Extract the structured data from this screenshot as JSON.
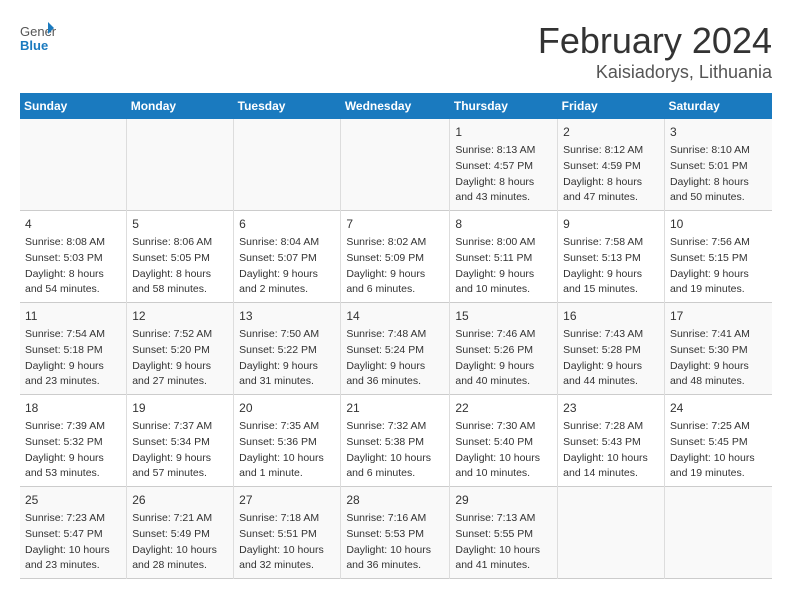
{
  "header": {
    "logo_general": "General",
    "logo_blue": "Blue",
    "title": "February 2024",
    "location": "Kaisiadorys, Lithuania"
  },
  "weekdays": [
    "Sunday",
    "Monday",
    "Tuesday",
    "Wednesday",
    "Thursday",
    "Friday",
    "Saturday"
  ],
  "weeks": [
    [
      {
        "day": "",
        "info": ""
      },
      {
        "day": "",
        "info": ""
      },
      {
        "day": "",
        "info": ""
      },
      {
        "day": "",
        "info": ""
      },
      {
        "day": "1",
        "info": "Sunrise: 8:13 AM\nSunset: 4:57 PM\nDaylight: 8 hours\nand 43 minutes."
      },
      {
        "day": "2",
        "info": "Sunrise: 8:12 AM\nSunset: 4:59 PM\nDaylight: 8 hours\nand 47 minutes."
      },
      {
        "day": "3",
        "info": "Sunrise: 8:10 AM\nSunset: 5:01 PM\nDaylight: 8 hours\nand 50 minutes."
      }
    ],
    [
      {
        "day": "4",
        "info": "Sunrise: 8:08 AM\nSunset: 5:03 PM\nDaylight: 8 hours\nand 54 minutes."
      },
      {
        "day": "5",
        "info": "Sunrise: 8:06 AM\nSunset: 5:05 PM\nDaylight: 8 hours\nand 58 minutes."
      },
      {
        "day": "6",
        "info": "Sunrise: 8:04 AM\nSunset: 5:07 PM\nDaylight: 9 hours\nand 2 minutes."
      },
      {
        "day": "7",
        "info": "Sunrise: 8:02 AM\nSunset: 5:09 PM\nDaylight: 9 hours\nand 6 minutes."
      },
      {
        "day": "8",
        "info": "Sunrise: 8:00 AM\nSunset: 5:11 PM\nDaylight: 9 hours\nand 10 minutes."
      },
      {
        "day": "9",
        "info": "Sunrise: 7:58 AM\nSunset: 5:13 PM\nDaylight: 9 hours\nand 15 minutes."
      },
      {
        "day": "10",
        "info": "Sunrise: 7:56 AM\nSunset: 5:15 PM\nDaylight: 9 hours\nand 19 minutes."
      }
    ],
    [
      {
        "day": "11",
        "info": "Sunrise: 7:54 AM\nSunset: 5:18 PM\nDaylight: 9 hours\nand 23 minutes."
      },
      {
        "day": "12",
        "info": "Sunrise: 7:52 AM\nSunset: 5:20 PM\nDaylight: 9 hours\nand 27 minutes."
      },
      {
        "day": "13",
        "info": "Sunrise: 7:50 AM\nSunset: 5:22 PM\nDaylight: 9 hours\nand 31 minutes."
      },
      {
        "day": "14",
        "info": "Sunrise: 7:48 AM\nSunset: 5:24 PM\nDaylight: 9 hours\nand 36 minutes."
      },
      {
        "day": "15",
        "info": "Sunrise: 7:46 AM\nSunset: 5:26 PM\nDaylight: 9 hours\nand 40 minutes."
      },
      {
        "day": "16",
        "info": "Sunrise: 7:43 AM\nSunset: 5:28 PM\nDaylight: 9 hours\nand 44 minutes."
      },
      {
        "day": "17",
        "info": "Sunrise: 7:41 AM\nSunset: 5:30 PM\nDaylight: 9 hours\nand 48 minutes."
      }
    ],
    [
      {
        "day": "18",
        "info": "Sunrise: 7:39 AM\nSunset: 5:32 PM\nDaylight: 9 hours\nand 53 minutes."
      },
      {
        "day": "19",
        "info": "Sunrise: 7:37 AM\nSunset: 5:34 PM\nDaylight: 9 hours\nand 57 minutes."
      },
      {
        "day": "20",
        "info": "Sunrise: 7:35 AM\nSunset: 5:36 PM\nDaylight: 10 hours\nand 1 minute."
      },
      {
        "day": "21",
        "info": "Sunrise: 7:32 AM\nSunset: 5:38 PM\nDaylight: 10 hours\nand 6 minutes."
      },
      {
        "day": "22",
        "info": "Sunrise: 7:30 AM\nSunset: 5:40 PM\nDaylight: 10 hours\nand 10 minutes."
      },
      {
        "day": "23",
        "info": "Sunrise: 7:28 AM\nSunset: 5:43 PM\nDaylight: 10 hours\nand 14 minutes."
      },
      {
        "day": "24",
        "info": "Sunrise: 7:25 AM\nSunset: 5:45 PM\nDaylight: 10 hours\nand 19 minutes."
      }
    ],
    [
      {
        "day": "25",
        "info": "Sunrise: 7:23 AM\nSunset: 5:47 PM\nDaylight: 10 hours\nand 23 minutes."
      },
      {
        "day": "26",
        "info": "Sunrise: 7:21 AM\nSunset: 5:49 PM\nDaylight: 10 hours\nand 28 minutes."
      },
      {
        "day": "27",
        "info": "Sunrise: 7:18 AM\nSunset: 5:51 PM\nDaylight: 10 hours\nand 32 minutes."
      },
      {
        "day": "28",
        "info": "Sunrise: 7:16 AM\nSunset: 5:53 PM\nDaylight: 10 hours\nand 36 minutes."
      },
      {
        "day": "29",
        "info": "Sunrise: 7:13 AM\nSunset: 5:55 PM\nDaylight: 10 hours\nand 41 minutes."
      },
      {
        "day": "",
        "info": ""
      },
      {
        "day": "",
        "info": ""
      }
    ]
  ]
}
